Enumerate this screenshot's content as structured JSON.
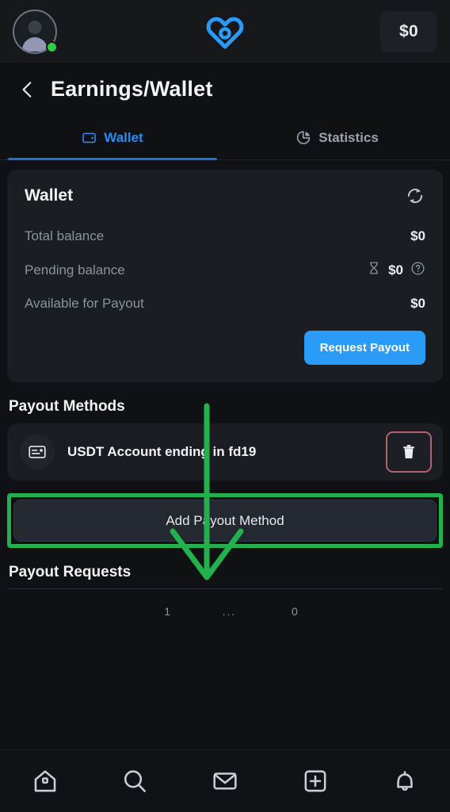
{
  "topbar": {
    "avatar_name": "user-avatar",
    "status": "online",
    "logo_name": "app-logo-heart",
    "balance_chip": "$0"
  },
  "page_header": {
    "back_label": "‹",
    "title": "Earnings/Wallet"
  },
  "tabs": [
    {
      "label": "Wallet",
      "icon": "wallet-icon",
      "active": true
    },
    {
      "label": "Statistics",
      "icon": "pie-chart-icon",
      "active": false
    }
  ],
  "wallet_card": {
    "title": "Wallet",
    "refresh_icon": "refresh-icon",
    "rows": [
      {
        "label": "Total balance",
        "value": "$0",
        "has_hourglass": false,
        "has_help": false
      },
      {
        "label": "Pending balance",
        "value": "$0",
        "has_hourglass": true,
        "has_help": true
      },
      {
        "label": "Available for Payout",
        "value": "$0",
        "has_hourglass": false,
        "has_help": false
      }
    ],
    "request_payout_label": "Request Payout"
  },
  "payout_methods": {
    "section_title": "Payout Methods",
    "items": [
      {
        "icon": "card-account-icon",
        "label": "USDT Account ending in fd19",
        "delete_icon": "trash-icon"
      }
    ],
    "add_button_label": "Add Payout Method"
  },
  "payout_requests": {
    "section_title": "Payout Requests",
    "row": [
      "1",
      "...",
      "0"
    ]
  },
  "bottom_nav": [
    {
      "name": "home-icon"
    },
    {
      "name": "search-icon"
    },
    {
      "name": "mail-icon"
    },
    {
      "name": "add-plus-icon"
    },
    {
      "name": "bell-icon"
    }
  ],
  "annotation": {
    "highlight_target": "Add Payout Method",
    "arrow_color": "#22b14c",
    "box_color": "#22b14c"
  },
  "colors": {
    "background": "#0f1114",
    "card": "#1a1d22",
    "accent_blue": "#2a9bf7",
    "tab_active": "#2a8cf0",
    "muted_text": "#8d939e",
    "danger_border": "#b4636b",
    "status_green": "#2ecc44"
  }
}
